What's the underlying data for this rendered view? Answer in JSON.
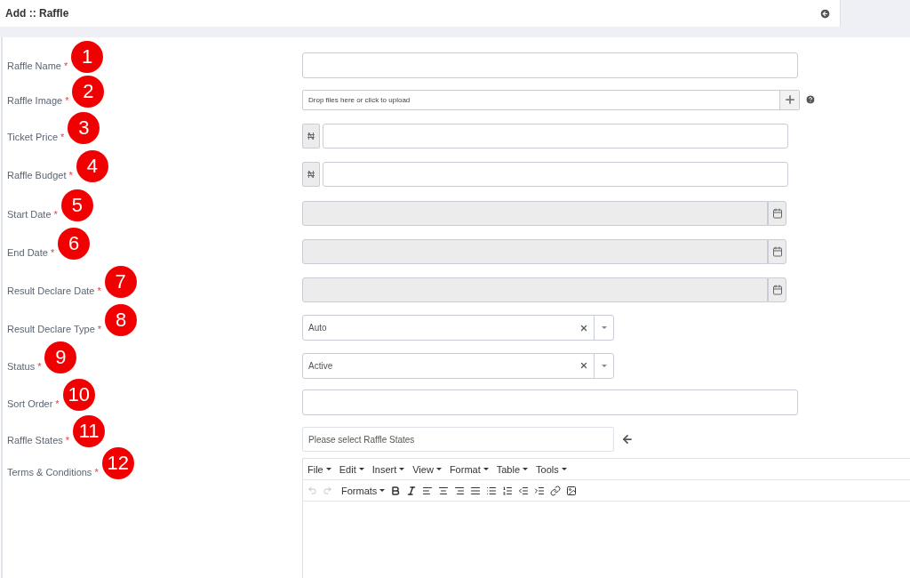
{
  "header": {
    "title": "Add :: Raffle"
  },
  "fields": [
    {
      "label": "Raffle Name",
      "required_mark": "*",
      "marker": "1",
      "kind": "text"
    },
    {
      "label": "Raffle Image",
      "required_mark": "*",
      "marker": "2",
      "kind": "upload",
      "placeholder": "Drop files here or click to upload"
    },
    {
      "label": "Ticket Price",
      "required_mark": "*",
      "marker": "3",
      "kind": "currency",
      "addon": "₦"
    },
    {
      "label": "Raffle Budget",
      "required_mark": "*",
      "marker": "4",
      "kind": "currency",
      "addon": "₦"
    },
    {
      "label": "Start Date",
      "required_mark": "*",
      "marker": "5",
      "kind": "date",
      "disabled": true
    },
    {
      "label": "End Date",
      "required_mark": "*",
      "marker": "6",
      "kind": "date",
      "disabled": true
    },
    {
      "label": "Result Declare Date",
      "required_mark": "*",
      "marker": "7",
      "kind": "date",
      "disabled": true
    },
    {
      "label": "Result Declare Type",
      "required_mark": "*",
      "marker": "8",
      "kind": "select",
      "value": "Auto"
    },
    {
      "label": "Status",
      "required_mark": "*",
      "marker": "9",
      "kind": "select",
      "value": "Active"
    },
    {
      "label": "Sort Order",
      "required_mark": "*",
      "marker": "10",
      "kind": "text"
    },
    {
      "label": "Raffle States",
      "required_mark": "*",
      "marker": "11",
      "kind": "tags",
      "placeholder": "Please select Raffle States"
    },
    {
      "label": "Terms & Conditions",
      "required_mark": "*",
      "marker": "12",
      "kind": "editor",
      "menus": [
        "File",
        "Edit",
        "Insert",
        "View",
        "Format",
        "Table",
        "Tools"
      ],
      "formats": "Formats"
    }
  ]
}
